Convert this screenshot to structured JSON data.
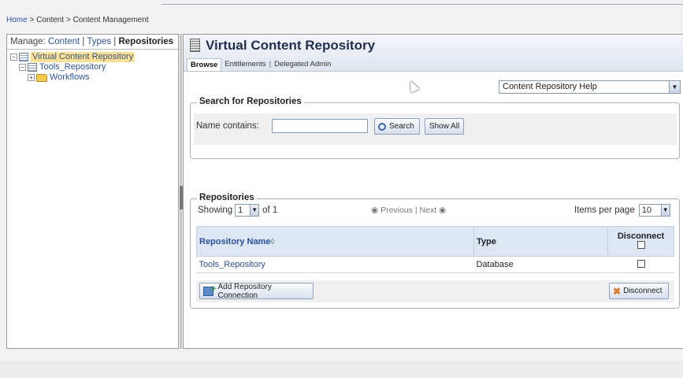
{
  "breadcrumb": {
    "home": "Home",
    "sep1": " > ",
    "content": "Content",
    "sep2": " > ",
    "current": "Content Management"
  },
  "left": {
    "manage_label": "Manage: ",
    "links": [
      "Content",
      "Types",
      "Repositories"
    ],
    "separator": " | ",
    "tree": [
      {
        "label": "Virtual Content Repository",
        "expander": "−",
        "selected": true
      },
      {
        "label": "Tools_Repository",
        "expander": "−"
      },
      {
        "label": "Workflows",
        "expander": "+"
      }
    ]
  },
  "main": {
    "title": "Virtual Content Repository",
    "tabs": [
      "Browse",
      "Entitlements",
      "Delegated Admin"
    ],
    "tab_separator": "|",
    "help_select": {
      "value": "Content Repository Help",
      "arrow": "▼"
    },
    "search": {
      "legend": "Search for Repositories",
      "name_label": "Name contains:",
      "name_value": "",
      "search_button": "Search",
      "show_all_button": "Show All"
    },
    "repositories": {
      "legend": "Repositories",
      "showing_label": "Showing",
      "page_value": "1",
      "of_label": "of 1",
      "previous": "◉ Previous",
      "next": "Next ◉",
      "pager_sep": "|",
      "items_per_page_label": "Items per page",
      "items_per_page_value": "10",
      "columns": {
        "name": "Repository Name",
        "type": "Type",
        "disconnect": "Disconnect"
      },
      "rows": [
        {
          "name": "Tools_Repository",
          "type": "Database"
        }
      ],
      "add_button": "Add Repository Connection",
      "disconnect_button": "Disconnect"
    }
  },
  "colors": {
    "link": "#2b54a6",
    "header_bg": "#dde6f3",
    "selected_bg": "#fde08a"
  }
}
